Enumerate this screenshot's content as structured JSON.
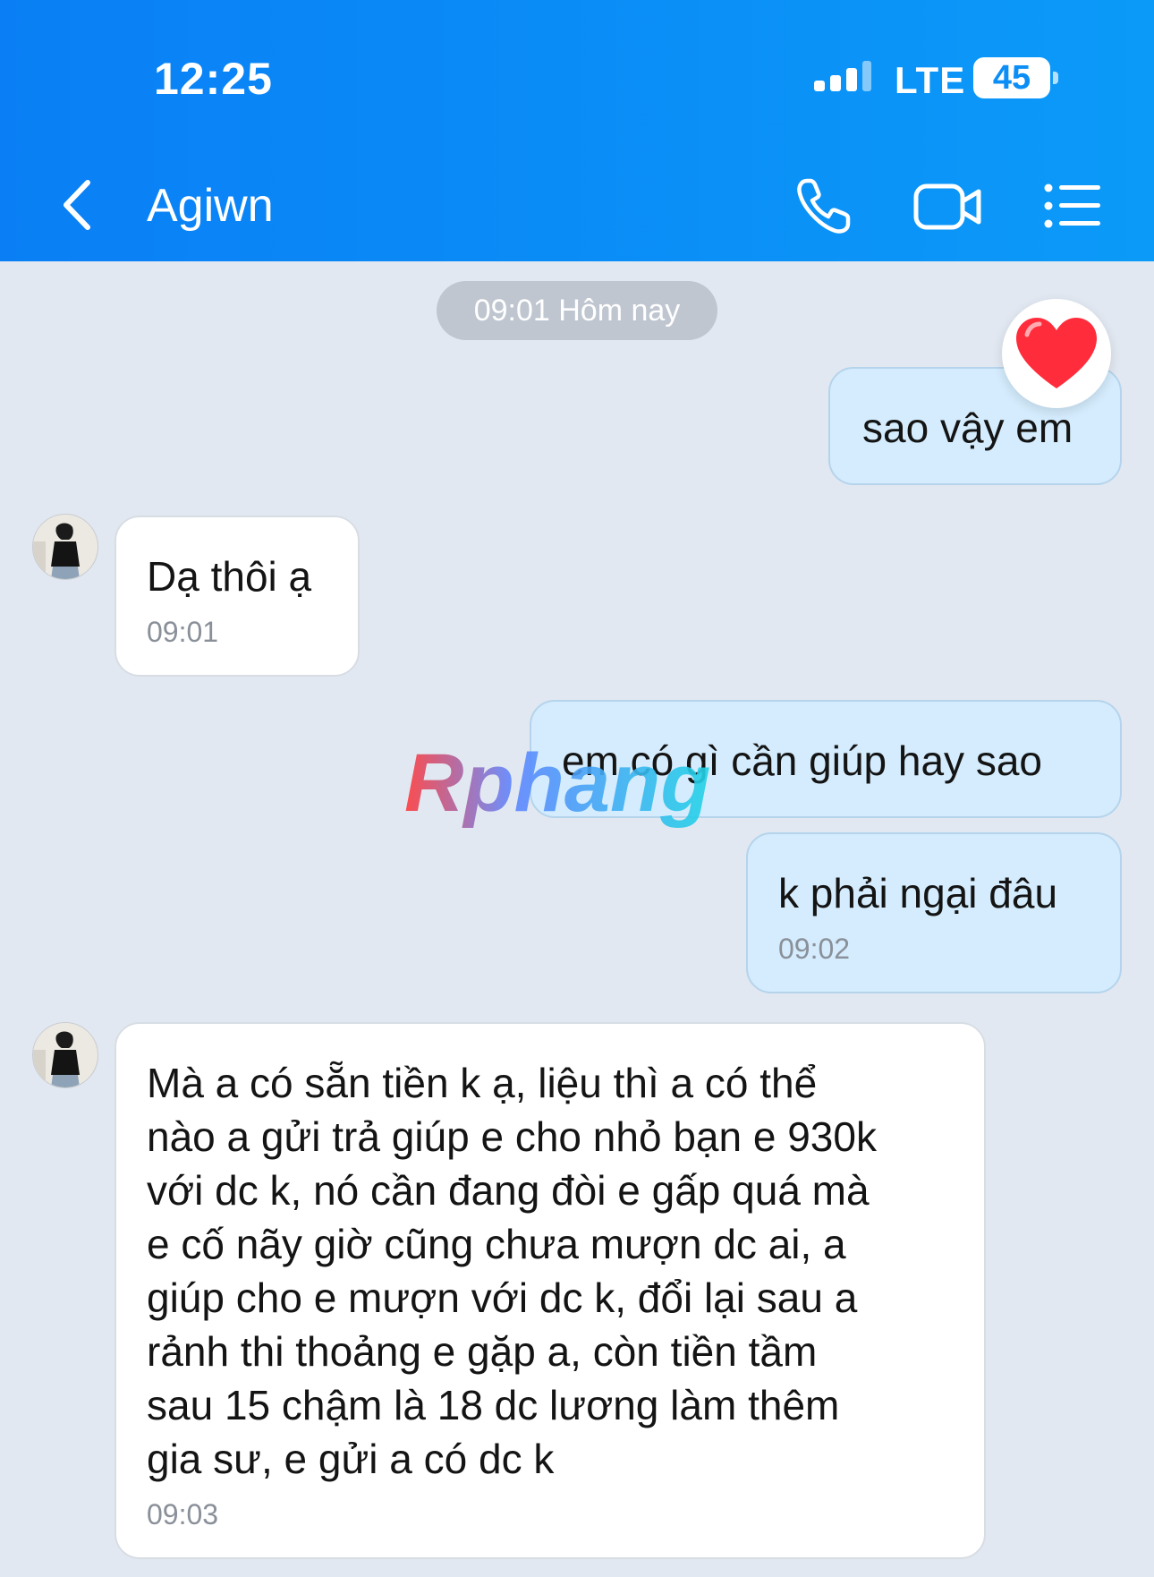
{
  "status_bar": {
    "time": "12:25",
    "network": "LTE",
    "battery": "45"
  },
  "header": {
    "title": "Agiwn"
  },
  "date_chip": "09:01 Hôm nay",
  "messages": [
    {
      "text": "sao vậy em",
      "time": ""
    },
    {
      "text": "Dạ thôi ạ",
      "time": "09:01"
    },
    {
      "text": "em có gì cần giúp hay sao",
      "time": ""
    },
    {
      "text": "k phải ngại đâu",
      "time": "09:02"
    },
    {
      "text": "Mà a có sẵn tiền k ạ, liệu thì a có thể\nnào a gửi trả giúp e cho nhỏ bạn e 930k\nvới dc k, nó cần đang đòi e gấp quá mà\ne cố nãy giờ cũng chưa mượn dc ai, a\ngiúp cho e mượn với dc k, đổi lại sau a\nrảnh thi thoảng e gặp a, còn tiền tầm\nsau 15 chậm là 18 dc lương làm thêm\ngia sư, e gửi a có dc k",
      "time": "09:03"
    }
  ],
  "watermark": "Rphang",
  "colors": {
    "header_start": "#0a7ff5",
    "header_end": "#0b9af8",
    "outgoing_bubble": "#d4ecfd",
    "incoming_bubble": "#ffffff",
    "chat_background": "#e2e8f1",
    "reaction": "#ff2d3c"
  },
  "icons": {
    "back": "chevron-left-icon",
    "call": "phone-icon",
    "video": "video-camera-icon",
    "menu": "list-menu-icon",
    "reaction": "heart-icon"
  }
}
